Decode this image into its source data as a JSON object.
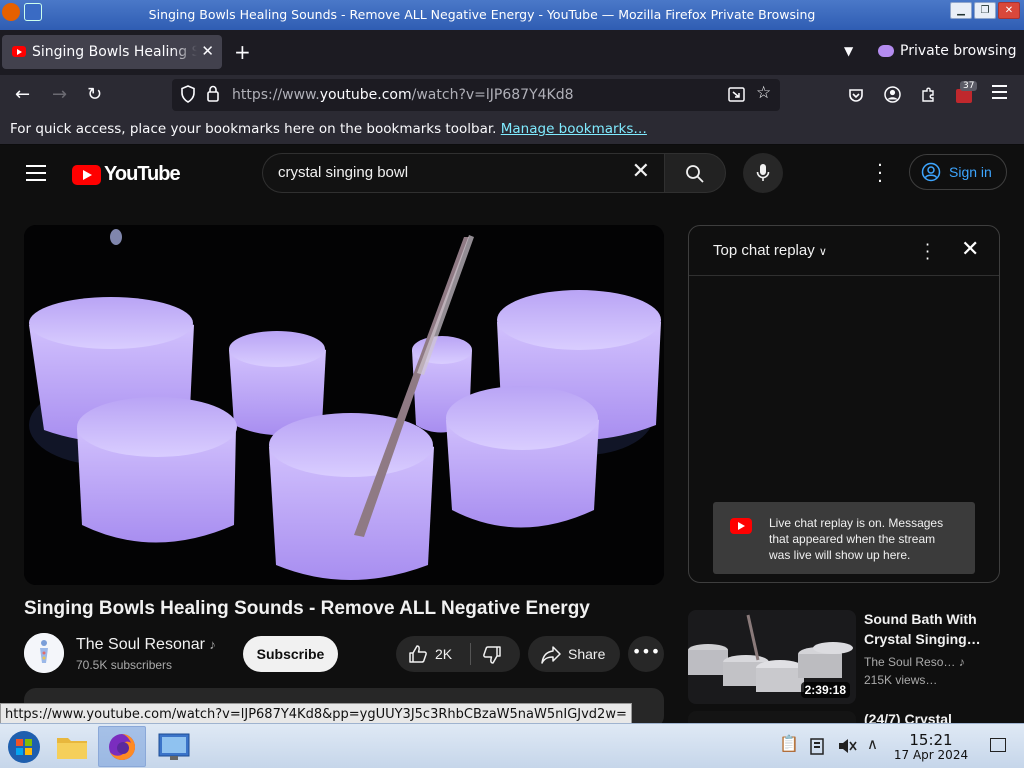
{
  "window": {
    "title": "Singing Bowls Healing Sounds - Remove ALL Negative Energy - YouTube — Mozilla Firefox Private Browsing"
  },
  "tabs": {
    "active_label": "Singing Bowls Healing Sounds - Remove ALL Negative Energy",
    "private_label": "Private browsing"
  },
  "nav": {
    "url_prefix": "https://www.",
    "url_domain": "youtube.com",
    "url_path": "/watch?v=lJP687Y4Kd8",
    "extension_badge": "37"
  },
  "bookmarks": {
    "message": "For quick access, place your bookmarks here on the bookmarks toolbar.",
    "link": "Manage bookmarks…"
  },
  "youtube": {
    "logo_text": "YouTube",
    "search_query": "crystal singing bowl",
    "sign_in": "Sign in"
  },
  "video": {
    "title": "Singing Bowls Healing Sounds - Remove ALL Negative Energy",
    "channel": "The Soul Resonar",
    "subscribers": "70.5K subscribers",
    "subscribe_label": "Subscribe",
    "likes": "2K",
    "share_label": "Share"
  },
  "chat": {
    "title": "Top chat replay",
    "notice": "Live chat replay is on. Messages that appeared when the stream was live will show up here."
  },
  "related": [
    {
      "title": "Sound Bath With Crystal Singing…",
      "channel": "The Soul Reso…",
      "views": "215K views…",
      "duration": "2:39:18"
    },
    {
      "title": "(24/7) Crystal"
    }
  ],
  "status_url": "https://www.youtube.com/watch?v=lJP687Y4Kd8&pp=ygUUY3J5c3RhbCBzaW5naW5nIGJvd2w=",
  "taskbar": {
    "time": "15:21",
    "date": "17 Apr 2024"
  },
  "colors": {
    "youtube_red": "#ff0000",
    "link_blue": "#3ea6ff",
    "bowl_violet": "#c9b3ff"
  }
}
